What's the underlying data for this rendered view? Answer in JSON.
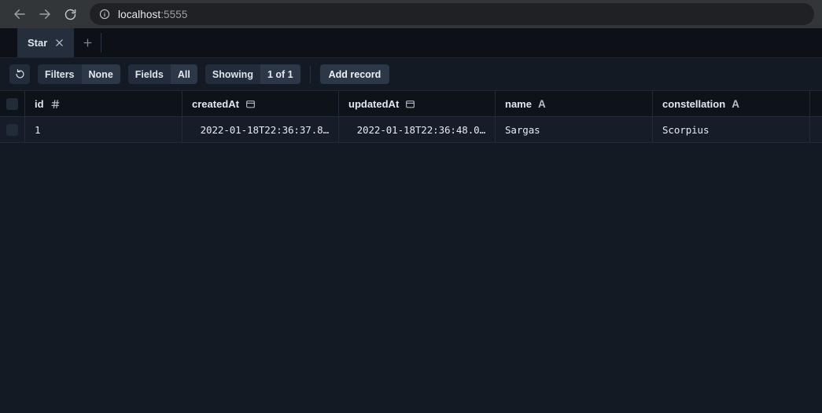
{
  "browser": {
    "back_icon": "back-arrow-icon",
    "forward_icon": "forward-arrow-icon",
    "reload_icon": "reload-icon",
    "site_info_icon": "site-info-icon",
    "url_host": "localhost",
    "url_port": ":5555",
    "url_full": "localhost:5555"
  },
  "tabs": {
    "items": [
      {
        "label": "Star",
        "close_label": "✕",
        "active": true
      }
    ],
    "add_label": "+"
  },
  "toolbar": {
    "refresh_icon": "refresh-icon",
    "filters_label": "Filters",
    "filters_value": "None",
    "fields_label": "Fields",
    "fields_value": "All",
    "showing_label": "Showing",
    "showing_value": "1 of 1",
    "add_record_label": "Add record"
  },
  "table": {
    "columns": [
      {
        "name": "id",
        "type_glyph": "#",
        "type_name": "number-type-icon"
      },
      {
        "name": "createdAt",
        "type_glyph": "Ὕ3",
        "type_name": "date-type-icon"
      },
      {
        "name": "updatedAt",
        "type_glyph": "Ὕ3",
        "type_name": "date-type-icon"
      },
      {
        "name": "name",
        "type_glyph": "A",
        "type_name": "string-type-icon"
      },
      {
        "name": "constellation",
        "type_glyph": "A",
        "type_name": "string-type-icon"
      }
    ],
    "rows": [
      {
        "id": "1",
        "createdAt": "2022-01-18T22:36:37.8…",
        "updatedAt": "2022-01-18T22:36:48.0…",
        "name": "Sargas",
        "constellation": "Scorpius"
      }
    ]
  },
  "colors": {
    "app_bg": "#141a23",
    "header_bg": "#0e131a",
    "row_bg": "#161d28",
    "chrome_bg": "#323639",
    "pill_bg": "#222c3a",
    "pill_value_bg": "#2c3747",
    "border": "#222b37"
  }
}
